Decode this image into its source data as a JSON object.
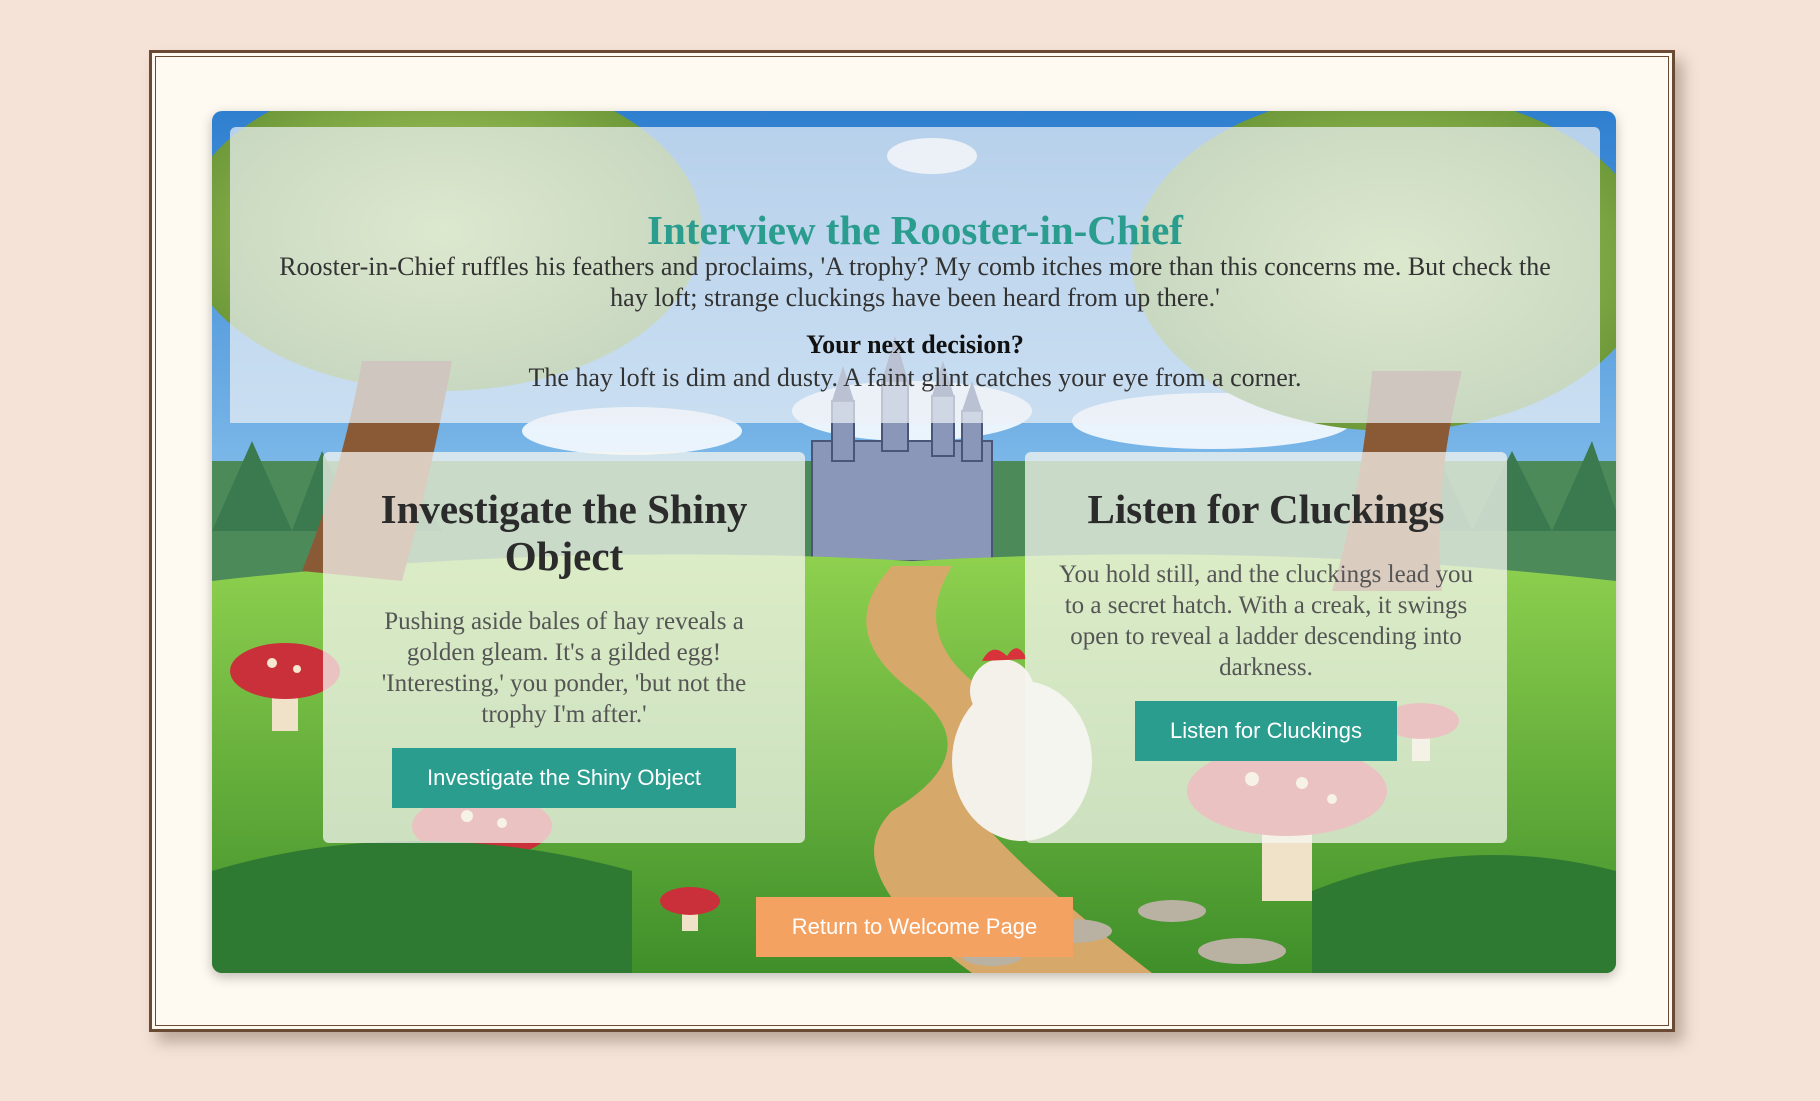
{
  "story": {
    "title": "Interview the Rooster-in-Chief",
    "text": "Rooster-in-Chief ruffles his feathers and proclaims, 'A trophy? My comb itches more than this concerns me. But check the hay loft; strange cluckings have been heard from up there.'",
    "decision_heading": "Your next decision?",
    "decision_text": "The hay loft is dim and dusty. A faint glint catches your eye from a corner."
  },
  "choices": [
    {
      "title": "Investigate the Shiny Object",
      "text": "Pushing aside bales of hay reveals a golden gleam. It's a gilded egg! 'Interesting,' you ponder, 'but not the trophy I'm after.'",
      "button_label": "Investigate the Shiny Object"
    },
    {
      "title": "Listen for Cluckings",
      "text": "You hold still, and the cluckings lead you to a secret hatch. With a creak, it swings open to reveal a ladder descending into darkness.",
      "button_label": "Listen for Cluckings"
    }
  ],
  "return_button": {
    "label": "Return to Welcome Page"
  },
  "colors": {
    "accent": "#2a9d8f",
    "return": "#f4a261",
    "page_bg": "#f5e3d8",
    "frame_bg": "#fefaf1"
  }
}
